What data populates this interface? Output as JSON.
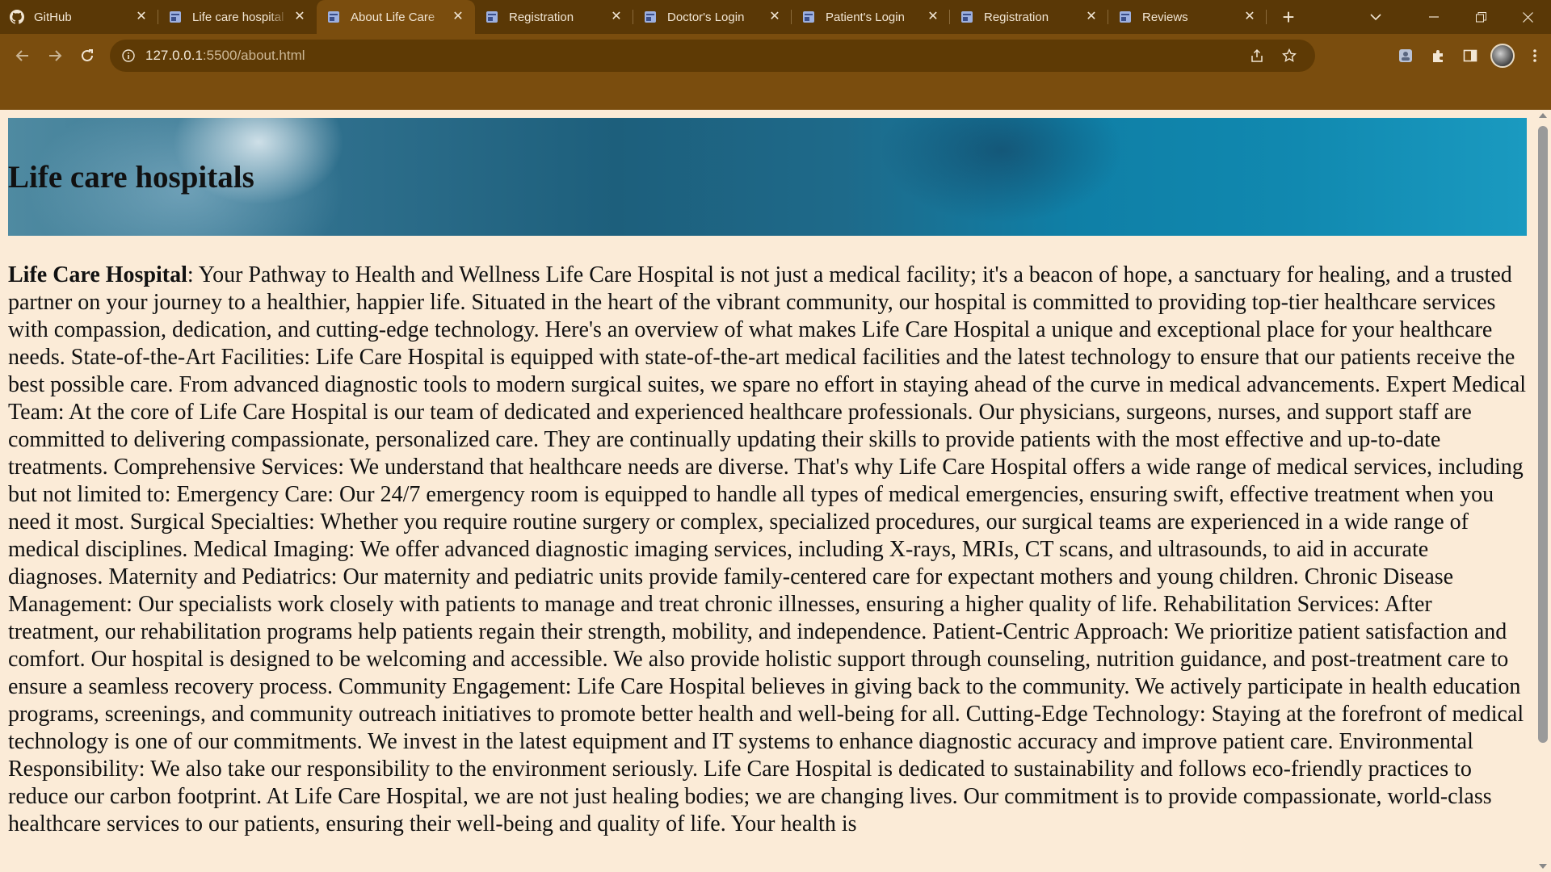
{
  "browser": {
    "tabs": [
      {
        "title": "GitHub",
        "icon": "github-icon",
        "active": false
      },
      {
        "title": "Life care hospital",
        "icon": "page-icon",
        "active": false
      },
      {
        "title": "About Life Care",
        "icon": "page-icon",
        "active": true
      },
      {
        "title": "Registration",
        "icon": "page-icon",
        "active": false
      },
      {
        "title": "Doctor's Login",
        "icon": "page-icon",
        "active": false
      },
      {
        "title": "Patient's Login",
        "icon": "page-icon",
        "active": false
      },
      {
        "title": "Registration",
        "icon": "page-icon",
        "active": false
      },
      {
        "title": "Reviews",
        "icon": "page-icon",
        "active": false
      }
    ],
    "url_host": "127.0.0.1",
    "url_path": ":5500/about.html",
    "theme_color": "#7a4d0e"
  },
  "page": {
    "banner_title": "Life care hospitals",
    "lead_bold": "Life Care Hospital",
    "body_text": ": Your Pathway to Health and Wellness Life Care Hospital is not just a medical facility; it's a beacon of hope, a sanctuary for healing, and a trusted partner on your journey to a healthier, happier life. Situated in the heart of the vibrant community, our hospital is committed to providing top-tier healthcare services with compassion, dedication, and cutting-edge technology. Here's an overview of what makes Life Care Hospital a unique and exceptional place for your healthcare needs. State-of-the-Art Facilities: Life Care Hospital is equipped with state-of-the-art medical facilities and the latest technology to ensure that our patients receive the best possible care. From advanced diagnostic tools to modern surgical suites, we spare no effort in staying ahead of the curve in medical advancements. Expert Medical Team: At the core of Life Care Hospital is our team of dedicated and experienced healthcare professionals. Our physicians, surgeons, nurses, and support staff are committed to delivering compassionate, personalized care. They are continually updating their skills to provide patients with the most effective and up-to-date treatments. Comprehensive Services: We understand that healthcare needs are diverse. That's why Life Care Hospital offers a wide range of medical services, including but not limited to: Emergency Care: Our 24/7 emergency room is equipped to handle all types of medical emergencies, ensuring swift, effective treatment when you need it most. Surgical Specialties: Whether you require routine surgery or complex, specialized procedures, our surgical teams are experienced in a wide range of medical disciplines. Medical Imaging: We offer advanced diagnostic imaging services, including X-rays, MRIs, CT scans, and ultrasounds, to aid in accurate diagnoses. Maternity and Pediatrics: Our maternity and pediatric units provide family-centered care for expectant mothers and young children. Chronic Disease Management: Our specialists work closely with patients to manage and treat chronic illnesses, ensuring a higher quality of life. Rehabilitation Services: After treatment, our rehabilitation programs help patients regain their strength, mobility, and independence. Patient-Centric Approach: We prioritize patient satisfaction and comfort. Our hospital is designed to be welcoming and accessible. We also provide holistic support through counseling, nutrition guidance, and post-treatment care to ensure a seamless recovery process. Community Engagement: Life Care Hospital believes in giving back to the community. We actively participate in health education programs, screenings, and community outreach initiatives to promote better health and well-being for all. Cutting-Edge Technology: Staying at the forefront of medical technology is one of our commitments. We invest in the latest equipment and IT systems to enhance diagnostic accuracy and improve patient care. Environmental Responsibility: We also take our responsibility to the environment seriously. Life Care Hospital is dedicated to sustainability and follows eco-friendly practices to reduce our carbon footprint. At Life Care Hospital, we are not just healing bodies; we are changing lives. Our commitment is to provide compassionate, world-class healthcare services to our patients, ensuring their well-being and quality of life. Your health is"
  }
}
